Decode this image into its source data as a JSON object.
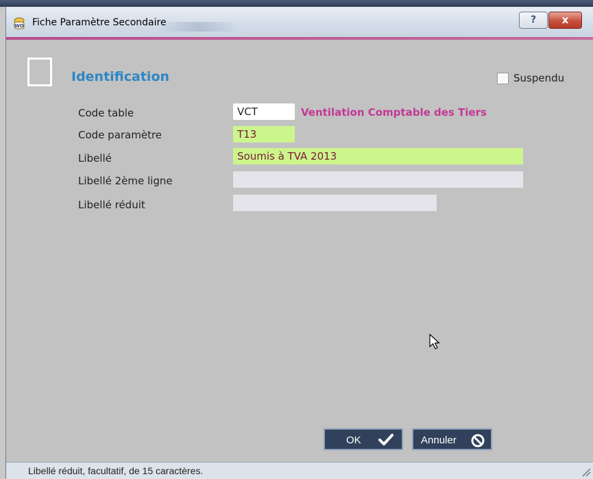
{
  "window": {
    "title": "Fiche Paramètre Secondaire",
    "help_glyph": "?",
    "close_glyph": "x"
  },
  "section": {
    "title": "Identification"
  },
  "suspendu": {
    "label": "Suspendu",
    "checked": false
  },
  "fields": {
    "code_table": {
      "label": "Code table",
      "value": "VCT",
      "description": "Ventilation Comptable des Tiers"
    },
    "code_parametre": {
      "label": "Code paramètre",
      "value": "T13"
    },
    "libelle": {
      "label": "Libellé",
      "value": "Soumis à TVA 2013"
    },
    "libelle_2": {
      "label": "Libellé 2ème ligne",
      "value": ""
    },
    "libelle_reduit": {
      "label": "Libellé réduit",
      "value": ""
    }
  },
  "buttons": {
    "ok": {
      "label": "OK",
      "icon": "checkmark-icon"
    },
    "cancel": {
      "label": "Annuler",
      "icon": "no-entry-icon"
    }
  },
  "statusbar": {
    "text": "Libellé réduit, facultatif, de 15 caractères."
  },
  "colors": {
    "accent": "#c33896",
    "title_blue": "#2f87c3",
    "required_field": "#ccf58c",
    "optional_field": "#e4e4ea",
    "button_bg": "#31415b"
  }
}
